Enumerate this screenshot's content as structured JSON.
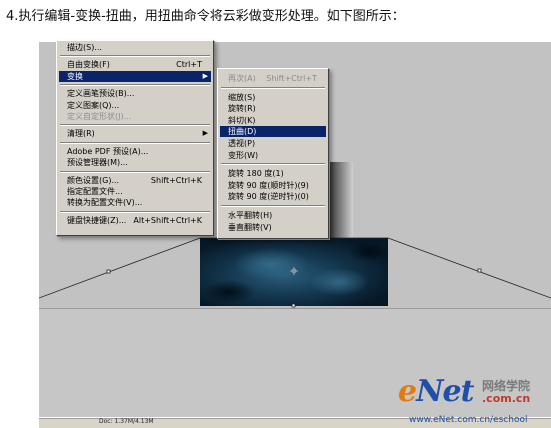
{
  "caption": "4.执行编辑-变换-扭曲，用扭曲命令将云彩做变形处理。如下图所示：",
  "edit_menu": {
    "items": [
      {
        "label": "描边(S)...",
        "shortcut": "",
        "submenu": false,
        "state": "normal",
        "name": "menu-item-stroke"
      },
      {
        "sep": true
      },
      {
        "label": "自由变换(F)",
        "shortcut": "Ctrl+T",
        "submenu": false,
        "state": "normal",
        "name": "menu-item-free-transform"
      },
      {
        "label": "变换",
        "shortcut": "",
        "submenu": true,
        "state": "highlighted",
        "name": "menu-item-transform"
      },
      {
        "sep": true
      },
      {
        "label": "定义画笔预设(B)...",
        "shortcut": "",
        "submenu": false,
        "state": "normal",
        "name": "menu-item-define-brush"
      },
      {
        "label": "定义图案(Q)...",
        "shortcut": "",
        "submenu": false,
        "state": "normal",
        "name": "menu-item-define-pattern"
      },
      {
        "label": "定义自定形状(J)...",
        "shortcut": "",
        "submenu": false,
        "state": "disabled",
        "name": "menu-item-define-shape"
      },
      {
        "sep": true
      },
      {
        "label": "清理(R)",
        "shortcut": "",
        "submenu": true,
        "state": "normal",
        "name": "menu-item-purge"
      },
      {
        "sep": true
      },
      {
        "label": "Adobe PDF 预设(A)...",
        "shortcut": "",
        "submenu": false,
        "state": "normal",
        "name": "menu-item-pdf-presets"
      },
      {
        "label": "预设管理器(M)...",
        "shortcut": "",
        "submenu": false,
        "state": "normal",
        "name": "menu-item-preset-manager"
      },
      {
        "sep": true
      },
      {
        "label": "颜色设置(G)...",
        "shortcut": "Shift+Ctrl+K",
        "submenu": false,
        "state": "normal",
        "name": "menu-item-color-settings"
      },
      {
        "label": "指定配置文件...",
        "shortcut": "",
        "submenu": false,
        "state": "normal",
        "name": "menu-item-assign-profile"
      },
      {
        "label": "转换为配置文件(V)...",
        "shortcut": "",
        "submenu": false,
        "state": "normal",
        "name": "menu-item-convert-profile"
      },
      {
        "sep": true
      },
      {
        "label": "键盘快捷键(Z)...",
        "shortcut": "Alt+Shift+Ctrl+K",
        "submenu": false,
        "state": "normal",
        "name": "menu-item-keyboard-shortcuts"
      }
    ]
  },
  "transform_menu": {
    "items": [
      {
        "label": "再次(A)",
        "shortcut": "Shift+Ctrl+T",
        "state": "disabled",
        "name": "menu-item-again"
      },
      {
        "sep": true
      },
      {
        "label": "缩放(S)",
        "shortcut": "",
        "state": "normal",
        "name": "menu-item-scale"
      },
      {
        "label": "旋转(R)",
        "shortcut": "",
        "state": "normal",
        "name": "menu-item-rotate"
      },
      {
        "label": "斜切(K)",
        "shortcut": "",
        "state": "normal",
        "name": "menu-item-skew"
      },
      {
        "label": "扭曲(D)",
        "shortcut": "",
        "state": "highlighted",
        "name": "menu-item-distort"
      },
      {
        "label": "透视(P)",
        "shortcut": "",
        "state": "normal",
        "name": "menu-item-perspective"
      },
      {
        "label": "变形(W)",
        "shortcut": "",
        "state": "normal",
        "name": "menu-item-warp"
      },
      {
        "sep": true
      },
      {
        "label": "旋转 180 度(1)",
        "shortcut": "",
        "state": "normal",
        "name": "menu-item-rotate-180"
      },
      {
        "label": "旋转 90 度(顺时针)(9)",
        "shortcut": "",
        "state": "normal",
        "name": "menu-item-rotate-90-cw"
      },
      {
        "label": "旋转 90 度(逆时针)(0)",
        "shortcut": "",
        "state": "normal",
        "name": "menu-item-rotate-90-ccw"
      },
      {
        "sep": true
      },
      {
        "label": "水平翻转(H)",
        "shortcut": "",
        "state": "normal",
        "name": "menu-item-flip-horizontal"
      },
      {
        "label": "垂直翻转(V)",
        "shortcut": "",
        "state": "normal",
        "name": "menu-item-flip-vertical"
      }
    ]
  },
  "status": {
    "zoom": "",
    "doc_info": "Doc: 1.37M/4.13M"
  },
  "watermark": {
    "logo_e": "e",
    "logo_rest": "Net",
    "logo_c": ".",
    "cn_text": "网络学院",
    "domain": ".com.cn",
    "url": "www.eNet.com.cn/eschool"
  },
  "colors": {
    "menu_bg": "#d4d0c8",
    "highlight": "#0a246a",
    "workspace": "#c2c2c2",
    "cloud_dark": "#061826",
    "cloud_light": "#2a5c7c"
  }
}
